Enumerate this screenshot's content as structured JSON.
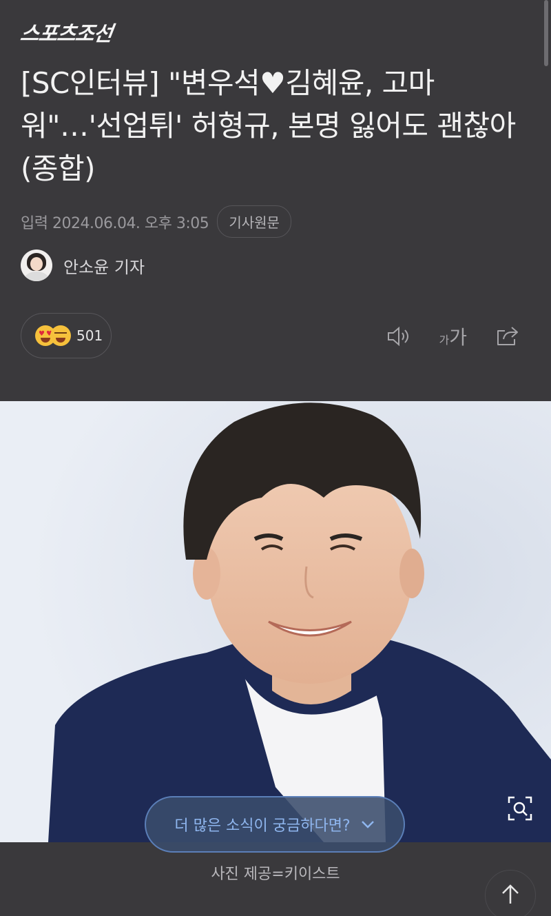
{
  "brand": {
    "name": "스포츠조선"
  },
  "article": {
    "title": "[SC인터뷰] \"변우석♥김혜윤, 고마워\"…'선업튀' 허형규, 본명 잃어도 괜찮아 (종합)",
    "published": "입력 2024.06.04. 오후 3:05",
    "origin_label": "기사원문",
    "reporter": "안소윤 기자"
  },
  "reactions": {
    "count": "501"
  },
  "toolbar": {
    "font_size_label_small": "가",
    "font_size_label_large": "가"
  },
  "cta": {
    "label": "더 많은 소식이 궁금하다면?"
  },
  "photo": {
    "caption": "사진 제공=키이스트"
  },
  "icons": {
    "audio": "speaker-icon",
    "font": "font-size-icon",
    "share": "share-icon",
    "zoom": "zoom-icon",
    "chevron": "chevron-down-icon",
    "top": "arrow-up-icon"
  },
  "colors": {
    "background": "#3a393c",
    "cta_text": "#8fb6ef",
    "cta_border": "#5b7fb8"
  }
}
